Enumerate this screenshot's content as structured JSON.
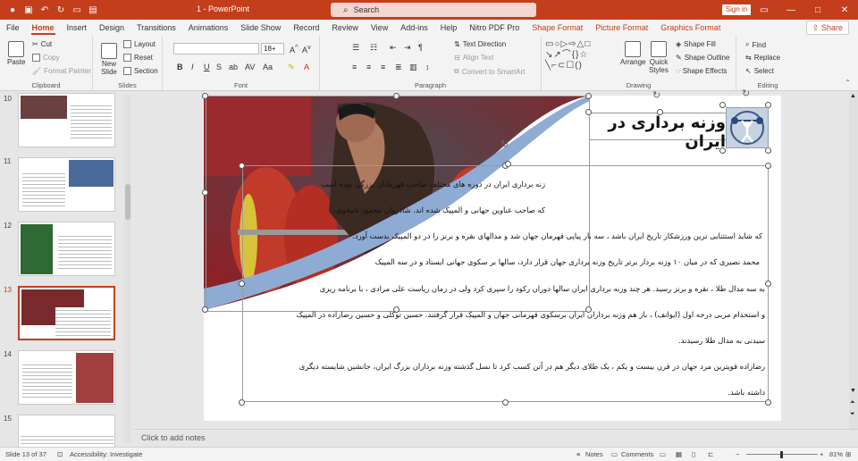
{
  "titlebar": {
    "doc_title": "1  -  PowerPoint",
    "search_placeholder": "Search",
    "signin": "Sign in"
  },
  "tabs": [
    {
      "label": "File"
    },
    {
      "label": "Home"
    },
    {
      "label": "Insert"
    },
    {
      "label": "Design"
    },
    {
      "label": "Transitions"
    },
    {
      "label": "Animations"
    },
    {
      "label": "Slide Show"
    },
    {
      "label": "Record"
    },
    {
      "label": "Review"
    },
    {
      "label": "View"
    },
    {
      "label": "Add-ins"
    },
    {
      "label": "Help"
    },
    {
      "label": "Nitro PDF Pro"
    },
    {
      "label": "Shape Format"
    },
    {
      "label": "Picture Format"
    },
    {
      "label": "Graphics Format"
    }
  ],
  "share": "Share",
  "ribbon": {
    "clipboard": {
      "paste": "Paste",
      "cut": "Cut",
      "copy": "Copy",
      "format_painter": "Format Painter",
      "label": "Clipboard"
    },
    "slides": {
      "new_slide": "New Slide",
      "layout": "Layout",
      "reset": "Reset",
      "section": "Section",
      "label": "Slides"
    },
    "font": {
      "size": "18+",
      "label": "Font",
      "bold": "B",
      "italic": "I",
      "underline": "U",
      "strike": "S"
    },
    "paragraph": {
      "text_direction": "Text Direction",
      "align_text": "Align Text",
      "smartart": "Convert to SmartArt",
      "label": "Paragraph"
    },
    "drawing": {
      "arrange": "Arrange",
      "quick_styles": "Quick Styles",
      "shape_fill": "Shape Fill",
      "shape_outline": "Shape Outline",
      "shape_effects": "Shape Effects",
      "label": "Drawing"
    },
    "editing": {
      "find": "Find",
      "replace": "Replace",
      "select": "Select",
      "label": "Editing"
    }
  },
  "thumbnails": [
    {
      "num": "10"
    },
    {
      "num": "11"
    },
    {
      "num": "12"
    },
    {
      "num": "13"
    },
    {
      "num": "14"
    },
    {
      "num": "15"
    }
  ],
  "slide": {
    "title": "وزنه برداری در ایران",
    "lines": [
      "زنه برداری ایران در دوره های مختلف صاحب قهرمانان بزرگی بوده است",
      "که صاحب عناوین جهانی و المپیک شده اند. شادروان محمود نامجوی،",
      "که شاید استثنایی ترین ورزشکار تاریخ ایران باشد ، سه بار پیاپی قهرمان جهان شد و مدالهای نقره و برنز را در دو المپیک بدست آورد.",
      "محمد نصیری که در میان ۱۰ وزنه بردار برتر تاریخ وزنه برداری جهان قرار دارد، سالها بر سکوی جهانی ایستاد و در سه المپیک",
      "به سه مدال طلا ، نقره و برنز رسید. هر چند وزنه برداری ایران سالها دوران رکود را سپری کرد ولی در زمان ریاست علی مرادی ، با برنامه ریزی",
      "و استخدام مربی درجه اول (ایوانف) ، باز هم وزنه برداران ایران برسکوی قهرمانی جهان و المپیک قرار گرفتند. حسین توکلی و حسین رضازاده در المپیک",
      "سیدنی به مدال طلا رسیدند.",
      "رضازاده قویترین مرد جهان در قرن بیست و یکم ، یک طلای  دیگر هم در آتن کسب کرد تا نسل گذشته وزنه برداران بزرگ  ایران، جانشین شایسته دیگری",
      "داشته باشد."
    ]
  },
  "notes_placeholder": "Click to add notes",
  "status": {
    "slide_count": "Slide 13 of 37",
    "accessibility": "Accessibility: Investigate",
    "notes": "Notes",
    "comments": "Comments",
    "zoom": "81%"
  },
  "colors": {
    "accent": "#c43e1c",
    "ribbon_bg": "#f3f3f3",
    "wave_blue": "#8eabd4"
  }
}
